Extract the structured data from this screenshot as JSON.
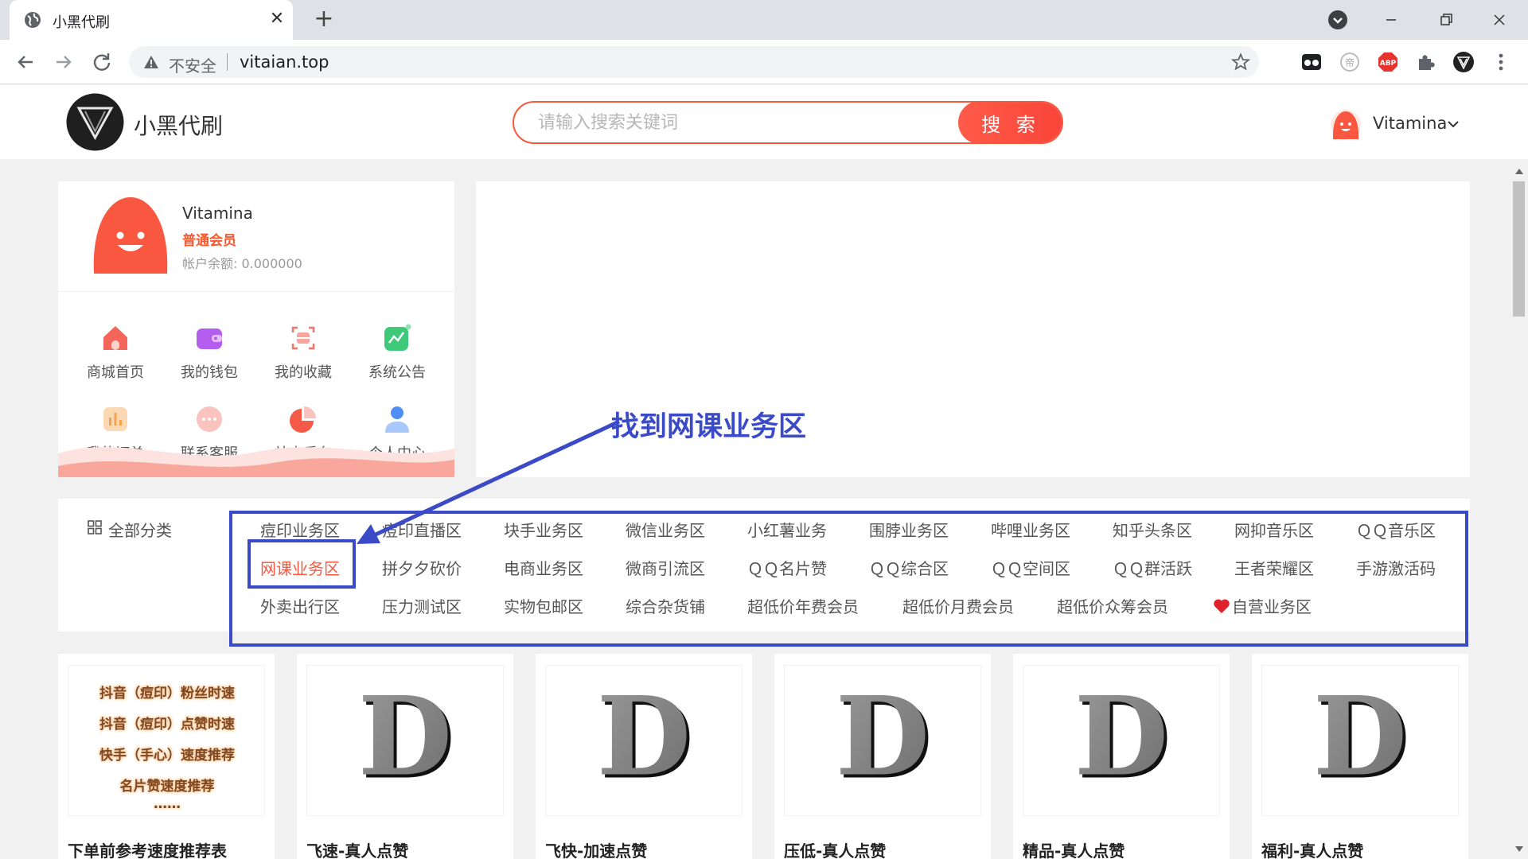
{
  "browser": {
    "tab_title": "小黑代刷",
    "insecure_label": "不安全",
    "url": "vitaian.top",
    "icons": [
      "globe-icon",
      "close-icon",
      "plus-icon",
      "profile-icon",
      "minimize-icon",
      "maximize-icon",
      "close-window-icon",
      "back-icon",
      "forward-icon",
      "reload-icon",
      "warning-icon",
      "star-icon",
      "extension-icon",
      "adblock-icon",
      "puzzle-icon",
      "menu-icon"
    ]
  },
  "header": {
    "site_name": "小黑代刷",
    "search_placeholder": "请输入搜索关键词",
    "search_button": "搜 索",
    "username": "Vitamina"
  },
  "user_card": {
    "name": "Vitamina",
    "level": "普通会员",
    "balance": "帐户余额: 0.000000",
    "menu": [
      {
        "label": "商城首页",
        "icon": "home-icon"
      },
      {
        "label": "我的钱包",
        "icon": "wallet-icon"
      },
      {
        "label": "我的收藏",
        "icon": "favorites-icon"
      },
      {
        "label": "系统公告",
        "icon": "announcement-icon"
      },
      {
        "label": "我的订单",
        "icon": "orders-icon"
      },
      {
        "label": "联系客服",
        "icon": "chat-icon"
      },
      {
        "label": "站点后台",
        "icon": "pie-chart-icon"
      },
      {
        "label": "个人中心",
        "icon": "person-icon"
      }
    ]
  },
  "categories": {
    "all_label": "全部分类",
    "rows": [
      [
        "痘印业务区",
        "痘印直播区",
        "块手业务区",
        "微信业务区",
        "小红薯业务",
        "围脖业务区",
        "哔哩业务区",
        "知乎头条区",
        "网抑音乐区",
        "ＱＱ音乐区"
      ],
      [
        "网课业务区",
        "拼夕夕砍价",
        "电商业务区",
        "微商引流区",
        "ＱＱ名片赞",
        "ＱＱ综合区",
        "ＱＱ空间区",
        "ＱＱ群活跃",
        "王者荣耀区",
        "手游激活码"
      ],
      [
        "外卖出行区",
        "压力测试区",
        "实物包邮区",
        "综合杂货铺",
        "超低价年费会员",
        "超低价月费会员",
        "超低价众筹会员",
        "自营业务区"
      ]
    ],
    "active": "网课业务区"
  },
  "annotation": {
    "text": "找到网课业务区",
    "color": "#3b4bc8"
  },
  "products": [
    {
      "title": "下单前参考速度推荐表",
      "promo_lines": [
        "抖音（痘印）粉丝时速",
        "抖音（痘印）点赞时速",
        "快手（手心）速度推荐",
        "名片赞速度推荐",
        "……"
      ]
    },
    {
      "title": "飞速-真人点赞",
      "thumb_letter": "D"
    },
    {
      "title": "飞快-加速点赞",
      "thumb_letter": "D"
    },
    {
      "title": "压低-真人点赞",
      "thumb_letter": "D"
    },
    {
      "title": "精品-真人点赞",
      "thumb_letter": "D"
    },
    {
      "title": "福利-真人点赞",
      "thumb_letter": "D"
    }
  ],
  "colors": {
    "accent": "#f9573f",
    "annotation_blue": "#3b4bc8"
  }
}
